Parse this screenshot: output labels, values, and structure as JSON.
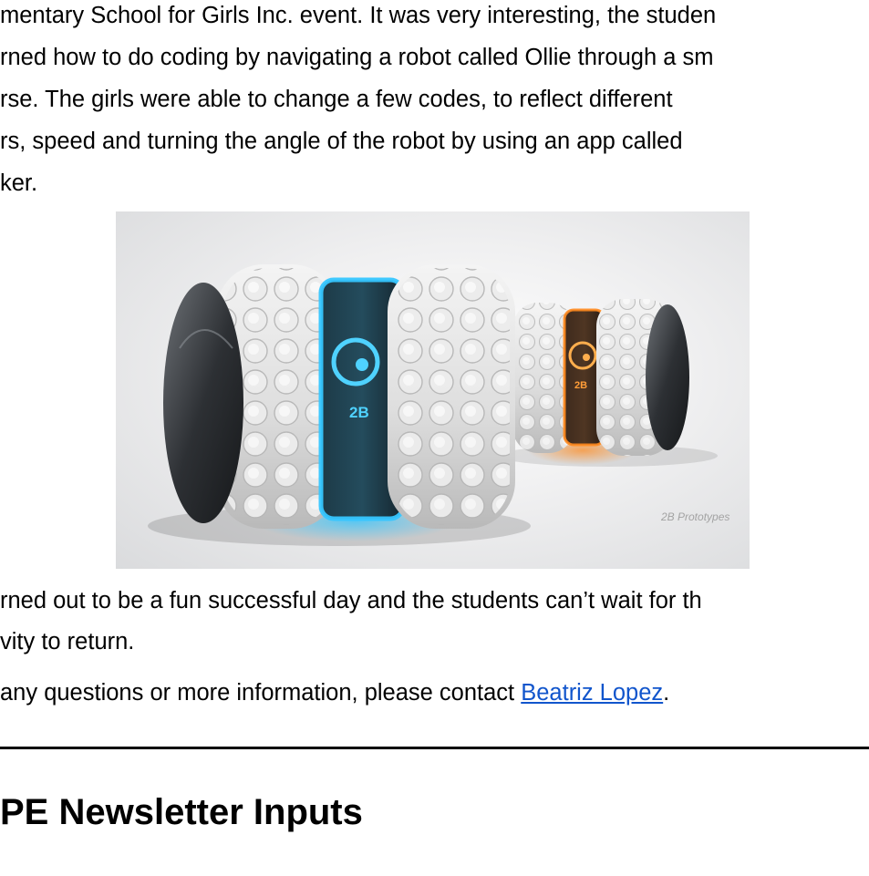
{
  "article": {
    "paragraph1_lines": [
      "mentary School for Girls Inc. event. It was very interesting, the studen",
      "rned how to do coding by navigating a robot called Ollie through a sm",
      "rse. The girls were able to change a few codes, to reflect different",
      "rs, speed and turning the angle of the robot by using an app called",
      "ker."
    ],
    "photo": {
      "robot_label_large": "2B",
      "robot_label_small": "2B",
      "watermark": "2B Prototypes",
      "accent_blue": "#36c6ff",
      "accent_orange": "#ff8a1e"
    },
    "paragraph2_lines": [
      "rned out to be a fun successful day and the students can’t wait for th",
      "vity to return."
    ],
    "contact": {
      "prefix": "any questions or more information, please contact ",
      "link_text": "Beatriz Lopez",
      "suffix": "."
    }
  },
  "section_heading": "PE Newsletter Inputs"
}
